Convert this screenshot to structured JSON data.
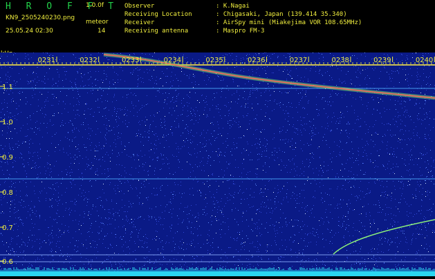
{
  "header": {
    "brand": "H R O F F T",
    "version": "1.0.0f",
    "filename": "KN9_2505240230.png",
    "meteor_label": "meteor",
    "timestamp": "25.05.24 02:30",
    "meteor_count": "14",
    "info": [
      {
        "label": "Observer",
        "value": ": K.Nagai"
      },
      {
        "label": "Receiving Location",
        "value": ": Chigasaki, Japan (139.414 35.340)"
      },
      {
        "label": "Receiver",
        "value": ": AirSpy mini (Miakejima VOR 108.65MHz)"
      },
      {
        "label": "Receiving antenna",
        "value": ": Maspro FM-3"
      }
    ]
  },
  "axis": {
    "unit": "kHz",
    "time_labels": [
      "0231",
      "0232",
      "0233",
      "0234",
      "0235",
      "0236",
      "0237",
      "0238",
      "0239",
      "0240"
    ],
    "freq_labels": [
      "1.1",
      "1.0",
      "0.9",
      "0.8",
      "0.7",
      "0.6"
    ]
  },
  "colors": {
    "background": "#000000",
    "text": "#f0ee3e",
    "brand": "#22d34a",
    "plot_bg": "#0a1a86",
    "noise_floor": "#2ad6f0",
    "tick": "#f0ee3e"
  }
}
